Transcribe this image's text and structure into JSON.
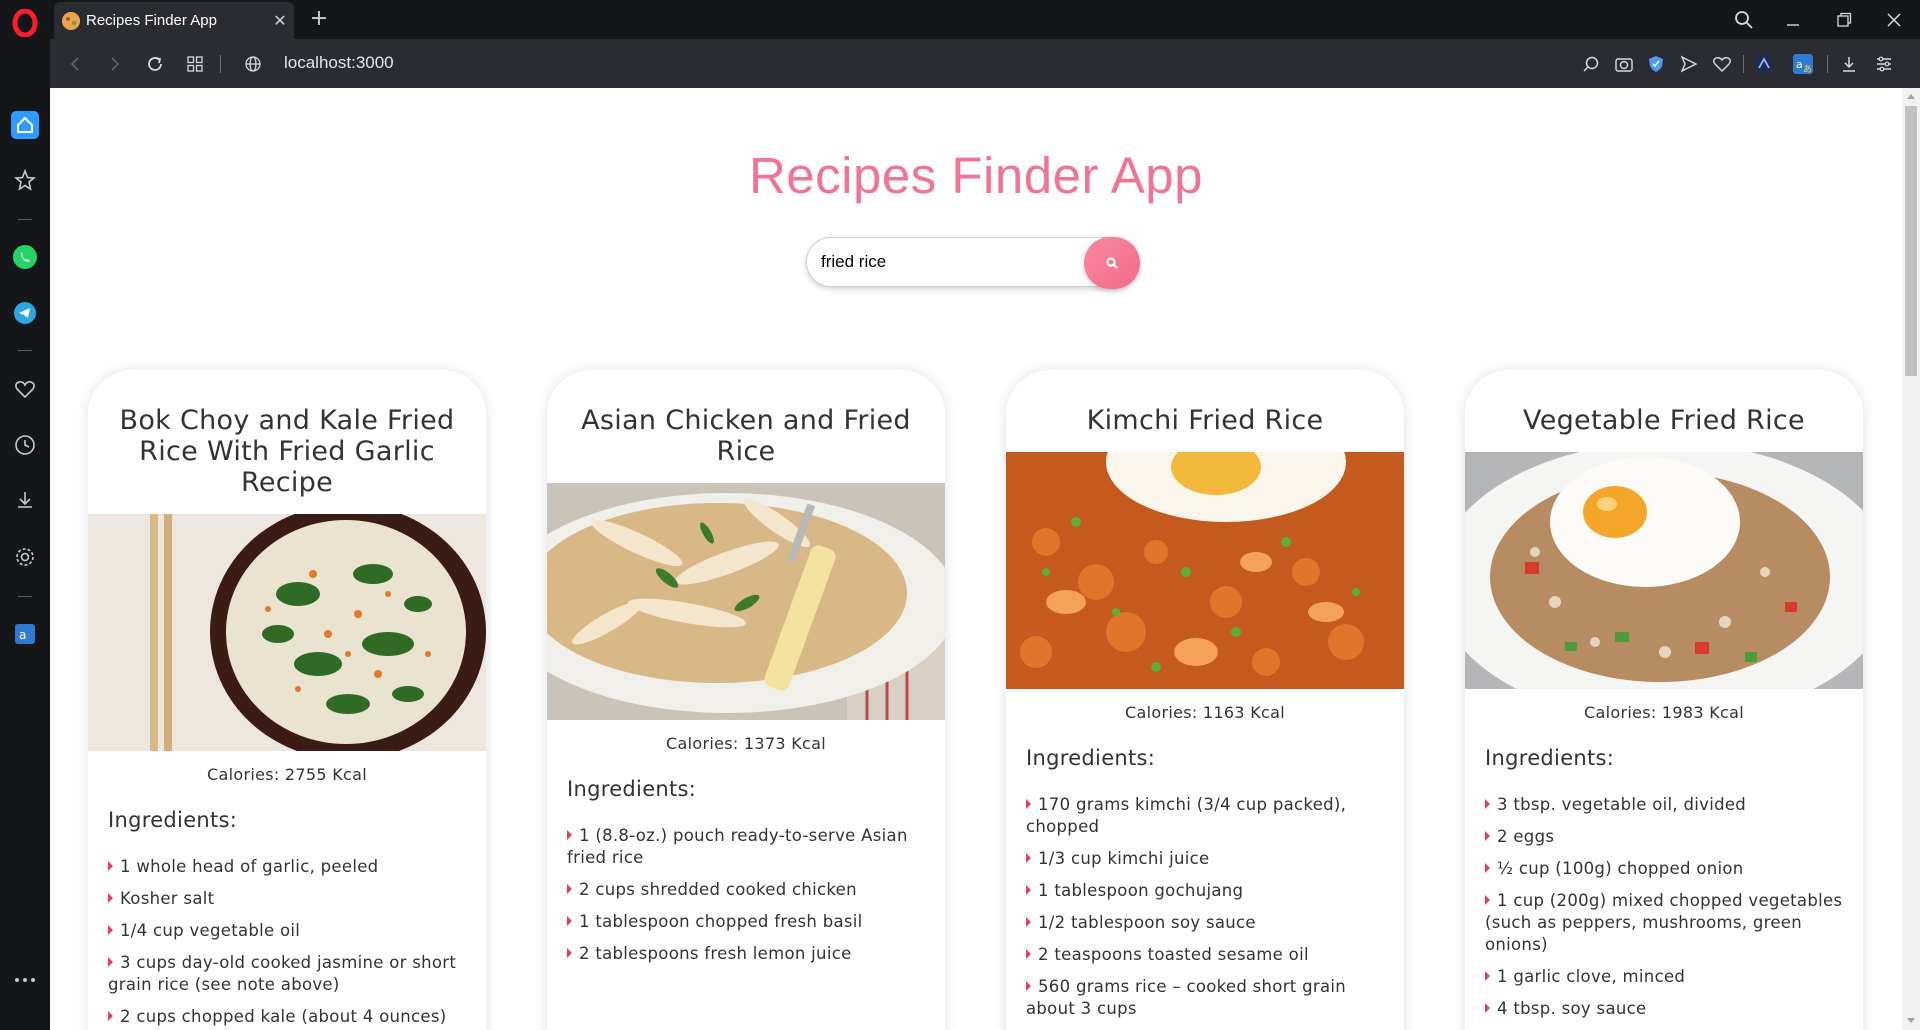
{
  "browser": {
    "tab_title": "Recipes Finder App",
    "url": "localhost:3000",
    "sidebar_icons": [
      "home-icon",
      "bookmarks-icon",
      "whatsapp-icon",
      "telegram-icon",
      "my-flow-icon",
      "history-icon",
      "downloads-icon",
      "settings-icon",
      "translator-icon",
      "more-icon"
    ],
    "toolbar_icons": [
      "search-tabs-icon",
      "snapshot-icon",
      "vpn-shield-icon",
      "send-icon",
      "heart-icon",
      "extension-icon",
      "translate-icon",
      "download-icon",
      "easy-setup-icon"
    ]
  },
  "app": {
    "title": "Recipes Finder App",
    "search": {
      "value": "fried rice",
      "button_icon": "search-icon"
    }
  },
  "labels": {
    "ingredients_heading": "Ingredients:"
  },
  "recipes": [
    {
      "title": "Bok Choy and Kale Fried Rice With Fried Garlic Recipe",
      "calories": "Calories: 2755 Kcal",
      "ingredients": [
        "1 whole head of garlic, peeled",
        "Kosher salt",
        "1/4 cup vegetable oil",
        "3 cups day-old cooked jasmine or short grain rice (see note above)",
        "2 cups chopped kale (about 4 ounces)"
      ]
    },
    {
      "title": "Asian Chicken and Fried Rice",
      "calories": "Calories: 1373 Kcal",
      "ingredients": [
        "1 (8.8-oz.) pouch ready-to-serve Asian fried rice",
        "2 cups shredded cooked chicken",
        "1 tablespoon chopped fresh basil",
        "2 tablespoons fresh lemon juice"
      ]
    },
    {
      "title": "Kimchi Fried Rice",
      "calories": "Calories: 1163 Kcal",
      "ingredients": [
        "170 grams kimchi (3/4 cup packed), chopped",
        "1/3 cup kimchi juice",
        "1 tablespoon gochujang",
        "1/2 tablespoon soy sauce",
        "2 teaspoons toasted sesame oil",
        "560 grams rice – cooked short grain about 3 cups"
      ]
    },
    {
      "title": "Vegetable Fried Rice",
      "calories": "Calories: 1983 Kcal",
      "ingredients": [
        "3 tbsp. vegetable oil, divided",
        "2 eggs",
        "½ cup (100g) chopped onion",
        "1 cup (200g) mixed chopped vegetables (such as peppers, mushrooms, green onions)",
        "1 garlic clove, minced",
        "4 tbsp. soy sauce"
      ]
    }
  ]
}
